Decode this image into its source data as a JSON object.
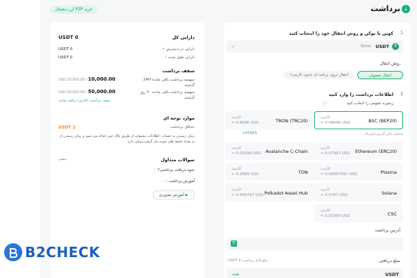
{
  "header": {
    "title": "برداشت",
    "p2p_pill": "خرید P2P ارز دیجیتال"
  },
  "step1": {
    "num": "1",
    "title": "کوین یا توکن و روش انتقال خود را انتخاب کنید",
    "coin_value": "USDT",
    "coin_sub": "Tether",
    "method_label": "روش انتقال",
    "method_options": [
      "انتقال معمولی",
      "انتقال درون برنامه ای (بدون کارمزد)"
    ]
  },
  "step2": {
    "num": "2",
    "title": "اطلاعات برداشت را وارد کنید",
    "chain_label": "زنجیره عمومی را انتخاب کنید",
    "fee_label": "کارمزد",
    "networks": [
      {
        "name": "BSC (BEP20)",
        "fee": "≈ 0.08696 USD",
        "selected": true
      },
      {
        "name": "TRON (TRC20)",
        "fee": "≈ 0.8596 USD",
        "selected": false
      },
      {
        "name": "Ethereum (ERC20)",
        "fee": "≈ 0.07997 USD",
        "selected": false
      },
      {
        "name": "Avalanche C-Chain",
        "fee": "≈ 0.03298 USD",
        "selected": false
      },
      {
        "name": "Plasma",
        "fee": "≈ 0.00007997 USD",
        "selected": false
      },
      {
        "name": "TON",
        "fee": "≈ 0.2699 USD",
        "selected": false
      },
      {
        "name": "Solana",
        "fee": "≈ 0.5797 USD",
        "selected": false
      },
      {
        "name": "Polkadot Asset Hub",
        "fee": "≈ 0.006797 USD",
        "selected": false
      },
      {
        "name": "CSC",
        "fee": "≈ 0.01099 USD",
        "selected": false
      }
    ],
    "net_code": "+97955",
    "net_code_label": "شماره پایان آدرس قرارداد",
    "address_label": "آدرس برداشت",
    "address_value": "",
    "amount_label": "مبلغ دریافتی",
    "amount_available": "مبلغ قابل برداشت USDT 0",
    "amount_unit": "USDT",
    "amount_max": "همه"
  },
  "sidebar": {
    "assets_title": "دارایی کل",
    "assets_total": "USDT 0",
    "asset_rows": [
      {
        "label": "دارایی در دسترس",
        "value": "USDT 0"
      },
      {
        "label": "دارایی قفل شده",
        "value": "USDT 0"
      }
    ],
    "limit_title": "سقف برداشت",
    "limit_rows": [
      {
        "label": "سهمیه برداشت باقی مانده 24H",
        "sub": "گذشته",
        "value": "10,000.00",
        "of": "USD 10,000.00 /"
      },
      {
        "label": "سهمیه برداشت باقی مانده ۳۰ روز",
        "sub": "گذشته",
        "value": "50,000.00",
        "of": "USD 50,000.00 /"
      }
    ],
    "limit_link": "سقف برداشت بالاتری دریافت نمایید",
    "notes_title": "موارد توجه ای",
    "min_label": "حداقل برداشت",
    "min_value": "USDT 2",
    "notes_text": "زمان رسیدن به حساب: اطلاعات معمولی از طریق بلاک چین انجام می شود و زمان رسیدن از یه تعداد دقیقه های حوره نیاز گرفته ممکن دارد.",
    "more_link": "بیشتر",
    "faq_title": "سوالات متداول",
    "faq_items": [
      "نحوه دریافت برداشتی؟",
      "آموزش برداشت"
    ],
    "video_label": "آموزش تصویری",
    "watermark": "B2CHECK"
  },
  "colors": {
    "accent": "#17b16e",
    "bg": "#f6f7f9",
    "warning": "#f08c1a",
    "watermark": "#1d5fc0"
  }
}
